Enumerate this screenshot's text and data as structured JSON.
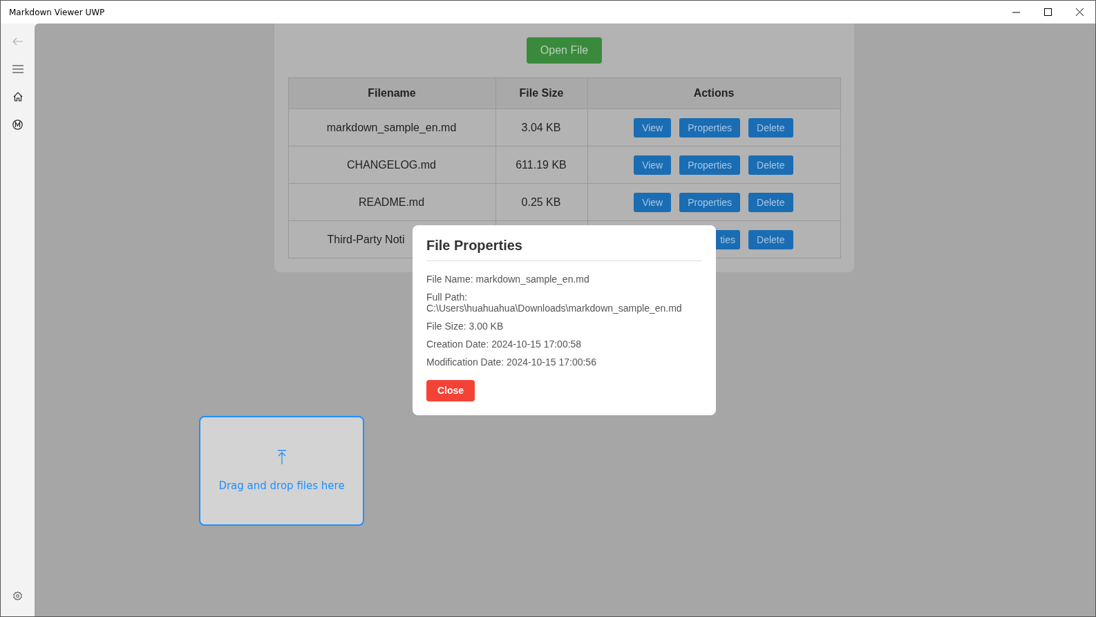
{
  "window": {
    "title": "Markdown Viewer UWP"
  },
  "sidebar": {
    "items": [
      {
        "disabled": true
      },
      {
        "disabled": false
      },
      {
        "disabled": false
      },
      {
        "disabled": false
      }
    ]
  },
  "open_button": "Open File",
  "table": {
    "columns": [
      "Filename",
      "File Size",
      "Actions"
    ],
    "rows": [
      {
        "filename": "markdown_sample_en.md",
        "size": "3.04 KB",
        "actions": [
          "View",
          "Properties",
          "Delete"
        ]
      },
      {
        "filename": "CHANGELOG.md",
        "size": "611.19 KB",
        "actions": [
          "View",
          "Properties",
          "Delete"
        ]
      },
      {
        "filename": "README.md",
        "size": "0.25 KB",
        "actions": [
          "View",
          "Properties",
          "Delete"
        ]
      },
      {
        "filename": "Third-Party Noti",
        "actions": [
          "ties",
          "Delete"
        ]
      }
    ]
  },
  "dropzone": {
    "label": "Drag and drop files here"
  },
  "dialog": {
    "title": "File Properties",
    "lines": [
      "File Name: markdown_sample_en.md",
      "Full Path:\nC:\\Users\\huahuahua\\Downloads\\markdown_sample_en.md",
      "File Size: 3.00 KB",
      "Creation Date: 2024-10-15 17:00:58",
      "Modification Date: 2024-10-15 17:00:56"
    ],
    "close": "Close"
  }
}
